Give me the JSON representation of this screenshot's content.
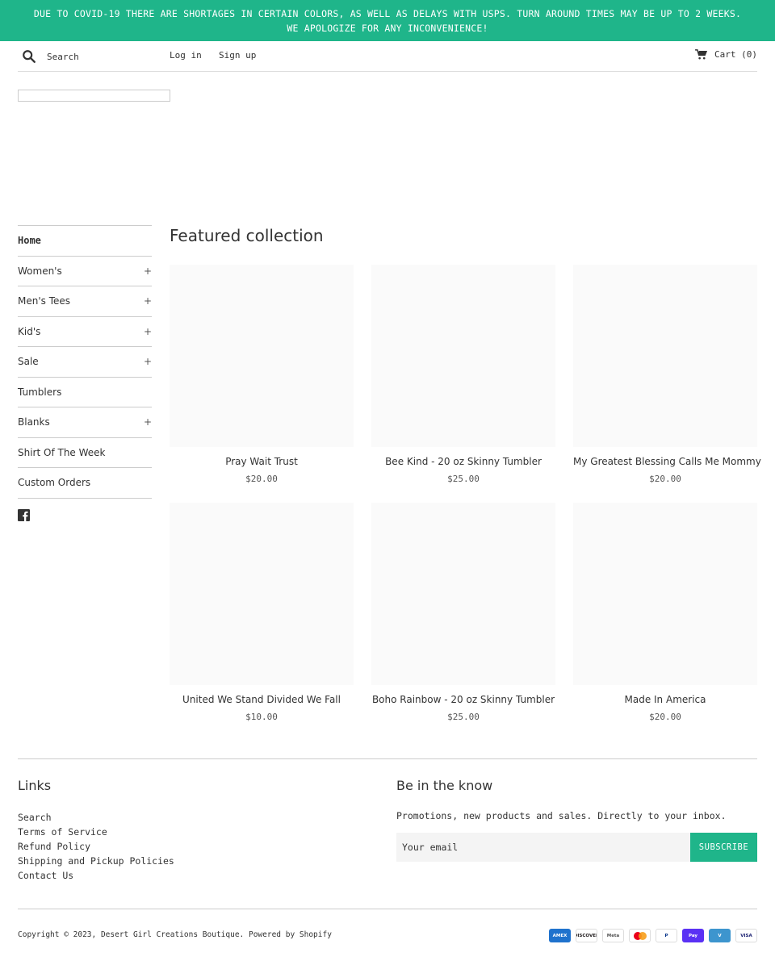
{
  "announcement": "DUE TO COVID-19 THERE ARE SHORTAGES IN CERTAIN COLORS, AS WELL AS DELAYS WITH USPS. TURN AROUND TIMES MAY BE UP TO 2 WEEKS. WE APOLOGIZE FOR ANY INCONVENIENCE!",
  "colors": {
    "accent": "#1fb58a"
  },
  "header": {
    "search_placeholder": "Search",
    "login": "Log in",
    "signup": "Sign up",
    "cart": "Cart (0)"
  },
  "sidebar": {
    "items": [
      {
        "label": "Home",
        "expandable": ""
      },
      {
        "label": "Women's",
        "expandable": "+"
      },
      {
        "label": "Men's Tees",
        "expandable": "+"
      },
      {
        "label": "Kid's",
        "expandable": "+"
      },
      {
        "label": "Sale",
        "expandable": "+"
      },
      {
        "label": "Tumblers",
        "expandable": ""
      },
      {
        "label": "Blanks",
        "expandable": "+"
      },
      {
        "label": "Shirt Of The Week",
        "expandable": ""
      },
      {
        "label": "Custom Orders",
        "expandable": ""
      }
    ],
    "social_icon": "facebook-icon"
  },
  "main": {
    "title": "Featured collection",
    "products": [
      {
        "title": "Pray Wait Trust",
        "price": "$20.00"
      },
      {
        "title": "Bee Kind - 20 oz Skinny Tumbler",
        "price": "$25.00"
      },
      {
        "title": "My Greatest Blessing Calls Me Mommy",
        "price": "$20.00"
      },
      {
        "title": "United We Stand Divided We Fall",
        "price": "$10.00"
      },
      {
        "title": "Boho Rainbow - 20 oz Skinny Tumbler",
        "price": "$25.00"
      },
      {
        "title": "Made In America",
        "price": "$20.00"
      }
    ]
  },
  "footer": {
    "links_title": "Links",
    "links": [
      "Search",
      "Terms of Service",
      "Refund Policy",
      "Shipping and Pickup Policies",
      "Contact Us"
    ],
    "newsletter_title": "Be in the know",
    "newsletter_text": "Promotions, new products and sales. Directly to your inbox.",
    "email_placeholder": "Your email",
    "subscribe": "SUBSCRIBE",
    "copyright": "Copyright © 2023, Desert Girl Creations Boutique. Powered by Shopify",
    "payments": [
      {
        "name": "amex-icon",
        "label": "AMEX",
        "bg": "#1f72cd",
        "fg": "#ffffff"
      },
      {
        "name": "discover-icon",
        "label": "DISCOVER",
        "bg": "#ffffff",
        "fg": "#231f20"
      },
      {
        "name": "meta-pay-icon",
        "label": "Meta",
        "bg": "#ffffff",
        "fg": "#555555"
      },
      {
        "name": "mastercard-icon",
        "label": "",
        "bg": "#ffffff",
        "fg": "#000000"
      },
      {
        "name": "paypal-icon",
        "label": "P",
        "bg": "#ffffff",
        "fg": "#003087"
      },
      {
        "name": "shop-pay-icon",
        "label": "Pay",
        "bg": "#5a31f4",
        "fg": "#ffffff"
      },
      {
        "name": "venmo-icon",
        "label": "V",
        "bg": "#3d95ce",
        "fg": "#ffffff"
      },
      {
        "name": "visa-icon",
        "label": "VISA",
        "bg": "#ffffff",
        "fg": "#1a1f71"
      }
    ]
  }
}
